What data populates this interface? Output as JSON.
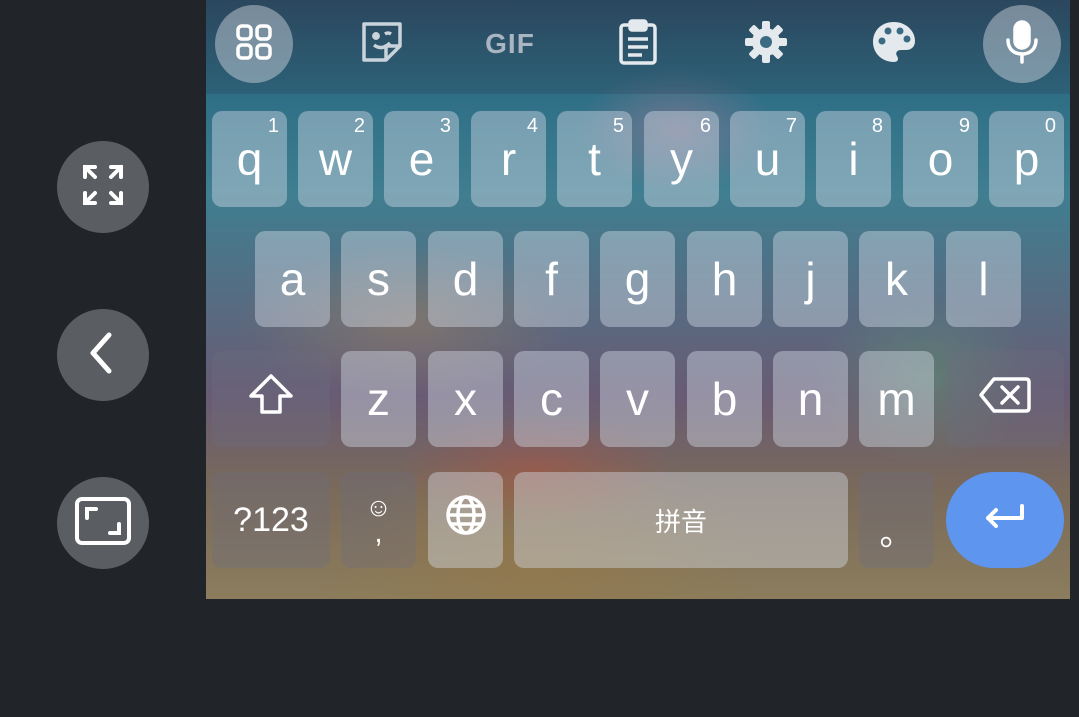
{
  "side_controls": [
    {
      "name": "expand-button",
      "icon": "expand-icon"
    },
    {
      "name": "back-button",
      "icon": "chevron-left-icon"
    },
    {
      "name": "fullscreen-button",
      "icon": "fullscreen-icon"
    }
  ],
  "toolbar": {
    "items": [
      {
        "name": "apps-button",
        "icon": "grid-icon"
      },
      {
        "name": "sticker-button",
        "icon": "sticker-icon"
      },
      {
        "name": "gif-button",
        "label": "GIF"
      },
      {
        "name": "clipboard-button",
        "icon": "clipboard-icon"
      },
      {
        "name": "settings-button",
        "icon": "gear-icon"
      },
      {
        "name": "theme-button",
        "icon": "palette-icon"
      },
      {
        "name": "voice-button",
        "icon": "microphone-icon"
      }
    ]
  },
  "keyboard": {
    "row1": [
      {
        "label": "q",
        "hint": "1"
      },
      {
        "label": "w",
        "hint": "2"
      },
      {
        "label": "e",
        "hint": "3"
      },
      {
        "label": "r",
        "hint": "4"
      },
      {
        "label": "t",
        "hint": "5"
      },
      {
        "label": "y",
        "hint": "6"
      },
      {
        "label": "u",
        "hint": "7"
      },
      {
        "label": "i",
        "hint": "8"
      },
      {
        "label": "o",
        "hint": "9"
      },
      {
        "label": "p",
        "hint": "0"
      }
    ],
    "row2": [
      "a",
      "s",
      "d",
      "f",
      "g",
      "h",
      "j",
      "k",
      "l"
    ],
    "row3": [
      "z",
      "x",
      "c",
      "v",
      "b",
      "n",
      "m"
    ],
    "symbols_label": "?123",
    "emoji_comma_top": "☺",
    "comma_label": ",",
    "space_label": "拼音",
    "period_label": "。"
  },
  "colors": {
    "enter_key": "#5e95ee",
    "background": "#212529"
  }
}
